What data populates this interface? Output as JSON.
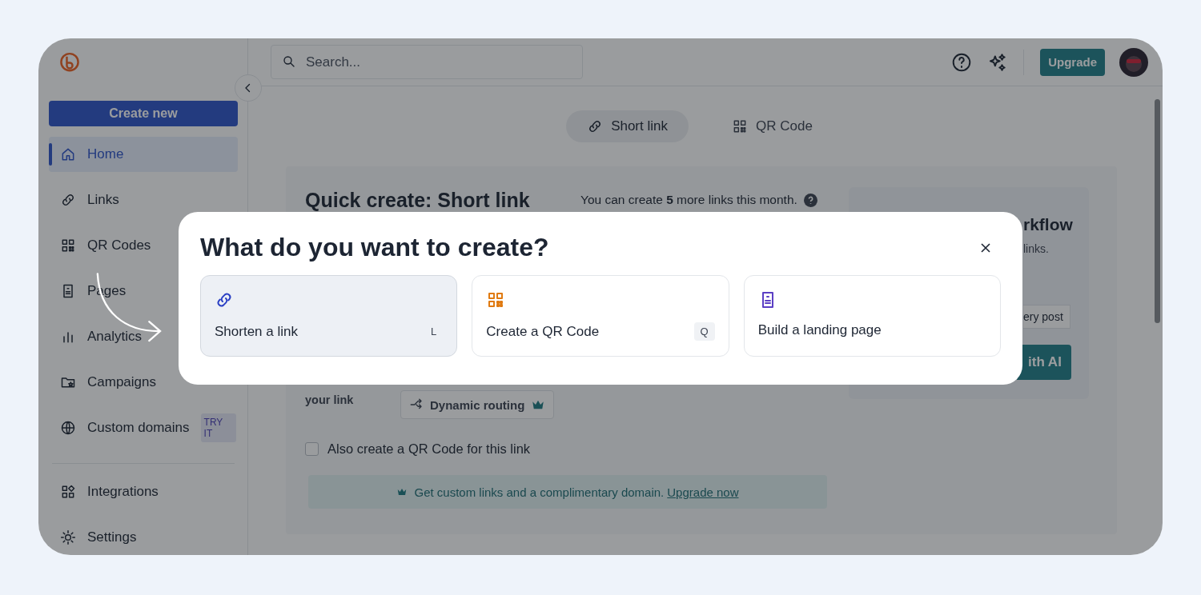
{
  "sidebar": {
    "create_button": "Create new",
    "items": [
      {
        "label": "Home",
        "selected": true
      },
      {
        "label": "Links",
        "selected": false
      },
      {
        "label": "QR Codes",
        "selected": false
      },
      {
        "label": "Pages",
        "selected": false
      },
      {
        "label": "Analytics",
        "selected": false
      },
      {
        "label": "Campaigns",
        "selected": false
      },
      {
        "label": "Custom domains",
        "selected": false,
        "badge": "TRY IT"
      }
    ],
    "bottom_items": [
      {
        "label": "Integrations",
        "selected": false
      },
      {
        "label": "Settings",
        "selected": false
      }
    ]
  },
  "topbar": {
    "search": {
      "placeholder": "Search..."
    },
    "upgrade_button": "Upgrade"
  },
  "content": {
    "tabs": [
      {
        "label": "Short link",
        "selected": true
      },
      {
        "label": "QR Code",
        "selected": false
      }
    ],
    "quick_create": {
      "title": "Quick create: Short link",
      "quota": "You can create **5** more links this month.",
      "field_label": "your link",
      "dynamic_routing": "Dynamic routing",
      "checkbox": {
        "label": "Also create a QR Code for this link",
        "checked": false
      },
      "banner": {
        "text": "Get custom links and a complimentary domain.",
        "link": "Upgrade now"
      }
    },
    "promo": {
      "title": "rkflow",
      "text": "links.",
      "chip": "ery post",
      "button": "ith AI"
    }
  },
  "modal": {
    "title": "What do you want to create?",
    "options": [
      {
        "label": "Shorten a link",
        "shortcut": "L",
        "selected": true
      },
      {
        "label": "Create a QR Code",
        "shortcut": "Q",
        "selected": false
      },
      {
        "label": "Build a landing page",
        "selected": false
      }
    ]
  }
}
